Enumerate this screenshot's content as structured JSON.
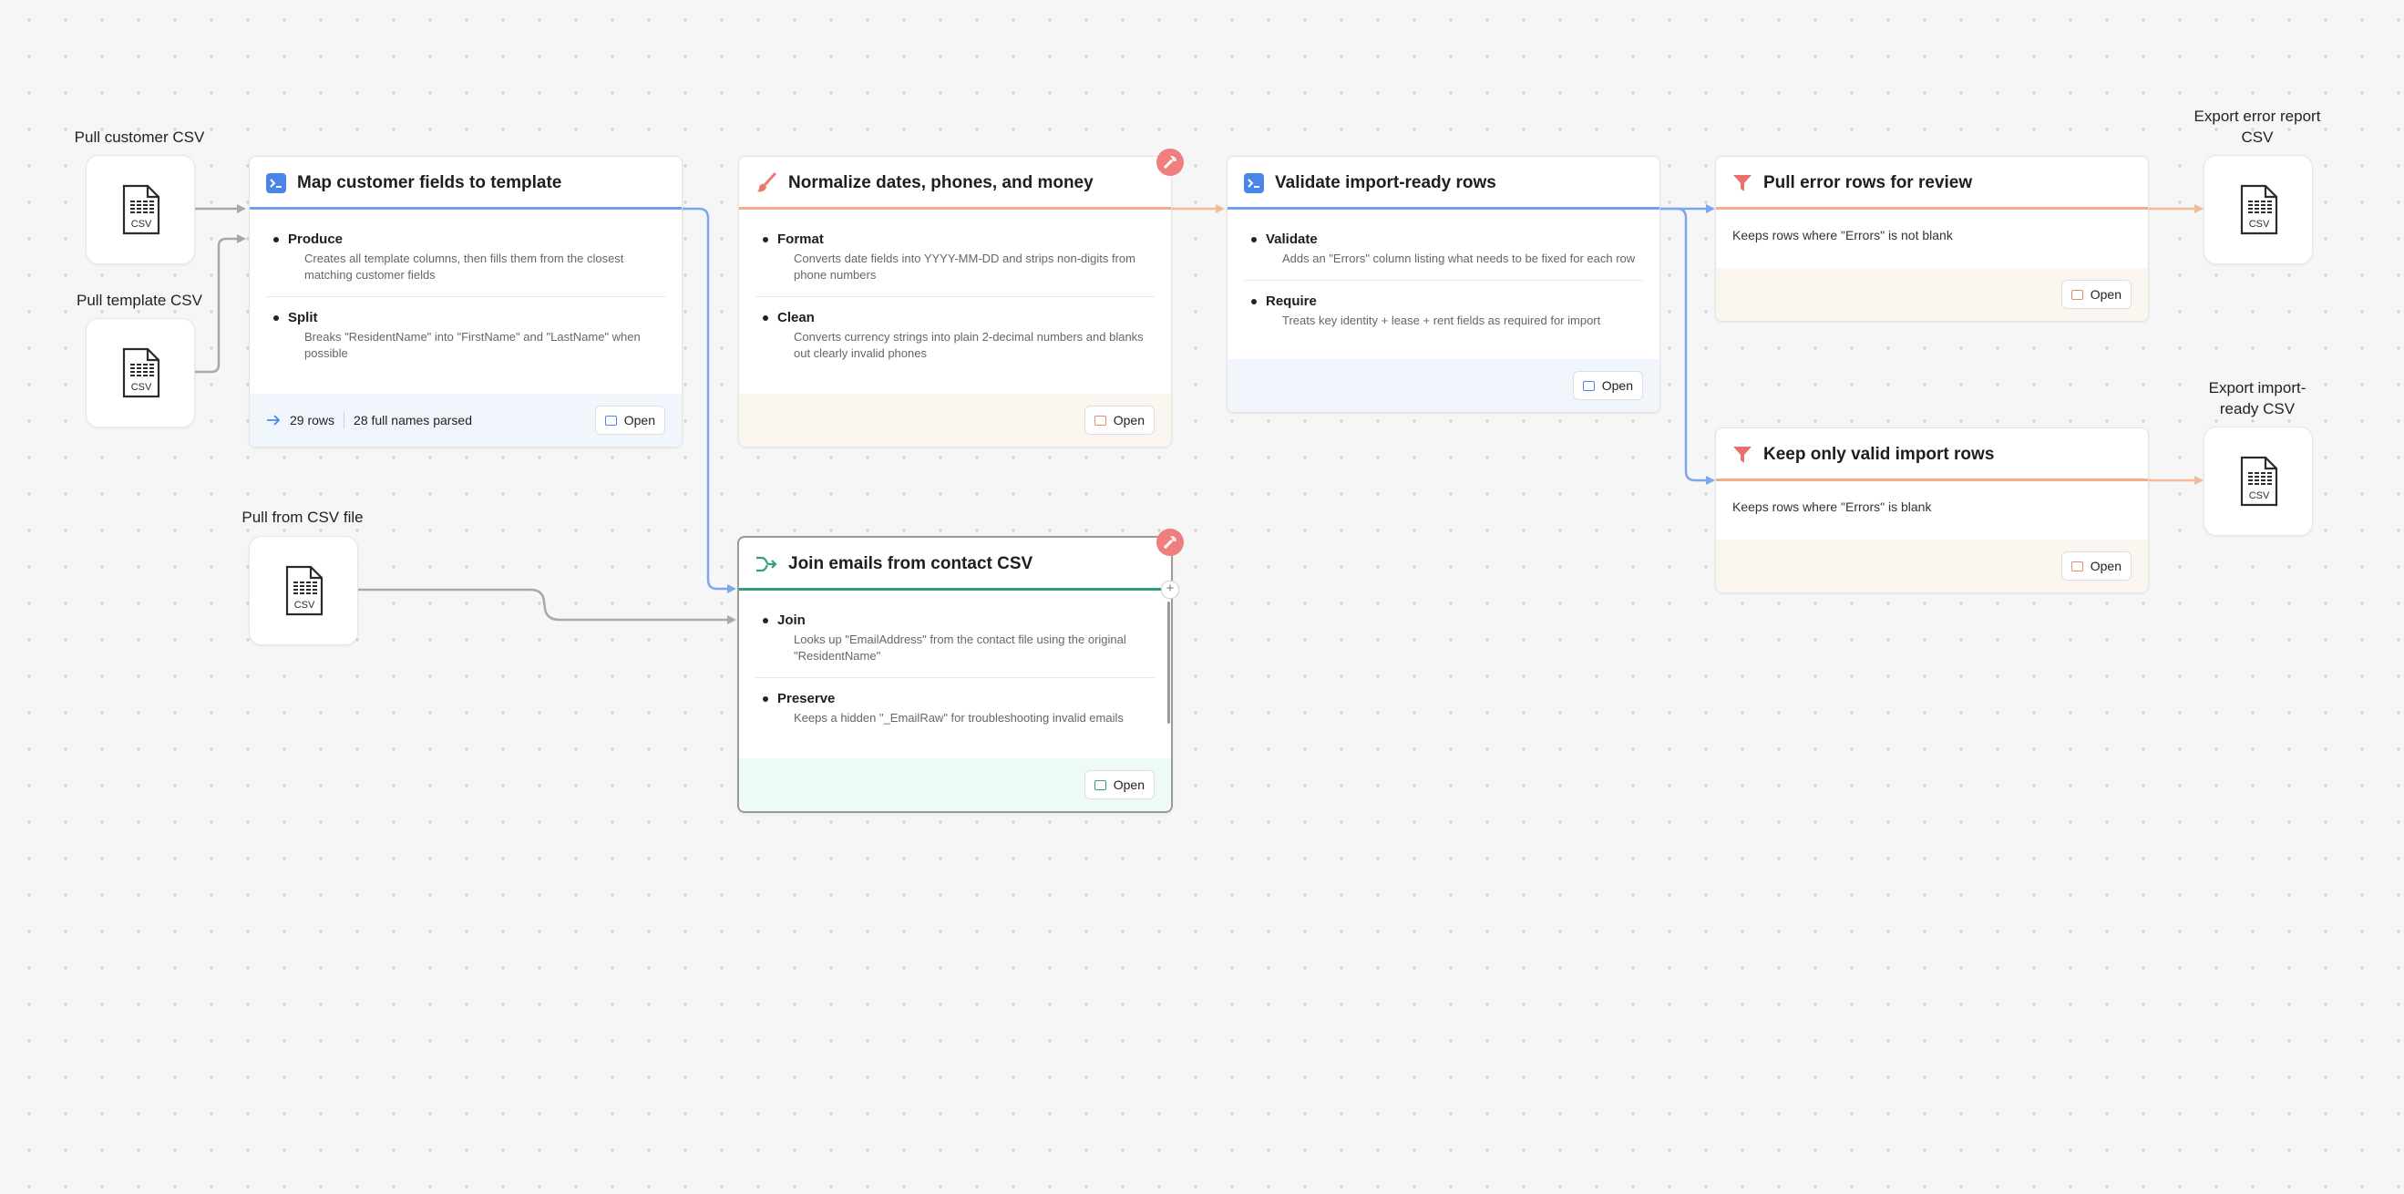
{
  "sources": {
    "pull_customer": {
      "label": "Pull customer CSV",
      "file_label": "CSV",
      "icon": "csv-file-icon"
    },
    "pull_template": {
      "label": "Pull template CSV",
      "file_label": "CSV",
      "icon": "csv-file-icon"
    },
    "pull_csv_file": {
      "label": "Pull from CSV file",
      "file_label": "CSV",
      "icon": "csv-file-icon"
    }
  },
  "exports": {
    "error_report": {
      "label": "Export error report CSV",
      "file_label": "CSV",
      "icon": "csv-file-icon"
    },
    "import_ready": {
      "label": "Export import-ready CSV",
      "file_label": "CSV",
      "icon": "csv-file-icon"
    }
  },
  "cards": {
    "map_fields": {
      "title": "Map customer fields to template",
      "icon": "terminal-icon",
      "accent": "#6f9ff0",
      "items": [
        {
          "title": "Produce",
          "desc": "Creates all template columns, then fills them from the closest matching customer fields"
        },
        {
          "title": "Split",
          "desc": "Breaks \"ResidentName\" into \"FirstName\" and \"LastName\" when possible"
        }
      ],
      "stats": {
        "rows": "29 rows",
        "parsed": "28 full names parsed"
      },
      "open_label": "Open"
    },
    "normalize": {
      "title": "Normalize dates, phones, and money",
      "icon": "brush-icon",
      "accent": "#f2ad8c",
      "items": [
        {
          "title": "Format",
          "desc": "Converts date fields into YYYY-MM-DD and strips non-digits from phone numbers"
        },
        {
          "title": "Clean",
          "desc": "Converts currency strings into plain 2-decimal numbers and blanks out clearly invalid phones"
        }
      ],
      "open_label": "Open"
    },
    "validate": {
      "title": "Validate import-ready rows",
      "icon": "terminal-icon",
      "accent": "#6f9ff0",
      "items": [
        {
          "title": "Validate",
          "desc": "Adds an \"Errors\" column listing what needs to be fixed for each row"
        },
        {
          "title": "Require",
          "desc": "Treats key identity + lease + rent fields as required for import"
        }
      ],
      "open_label": "Open"
    },
    "pull_errors": {
      "title": "Pull error rows for review",
      "icon": "filter-icon",
      "accent": "#f2ad8c",
      "desc": "Keeps rows where \"Errors\" is not blank",
      "open_label": "Open"
    },
    "keep_valid": {
      "title": "Keep only valid import rows",
      "icon": "filter-icon",
      "accent": "#f2ad8c",
      "desc": "Keeps rows where \"Errors\" is blank",
      "open_label": "Open"
    },
    "join_emails": {
      "title": "Join emails from contact CSV",
      "icon": "merge-icon",
      "accent": "#2f9f80",
      "items": [
        {
          "title": "Join",
          "desc": "Looks up \"EmailAddress\" from the contact file using the original \"ResidentName\""
        },
        {
          "title": "Preserve",
          "desc": "Keeps a hidden \"_EmailRaw\" for troubleshooting invalid emails"
        }
      ],
      "open_label": "Open"
    }
  },
  "colors": {
    "blue_edge": "#7ea6ef",
    "orange_edge": "#f2b99b",
    "gray_edge": "#a8a8a8",
    "badge": "#ef7f7f",
    "footer_blue": "#f1f5fc",
    "footer_orange": "#fbf6f0",
    "footer_green": "#eefbf5"
  }
}
